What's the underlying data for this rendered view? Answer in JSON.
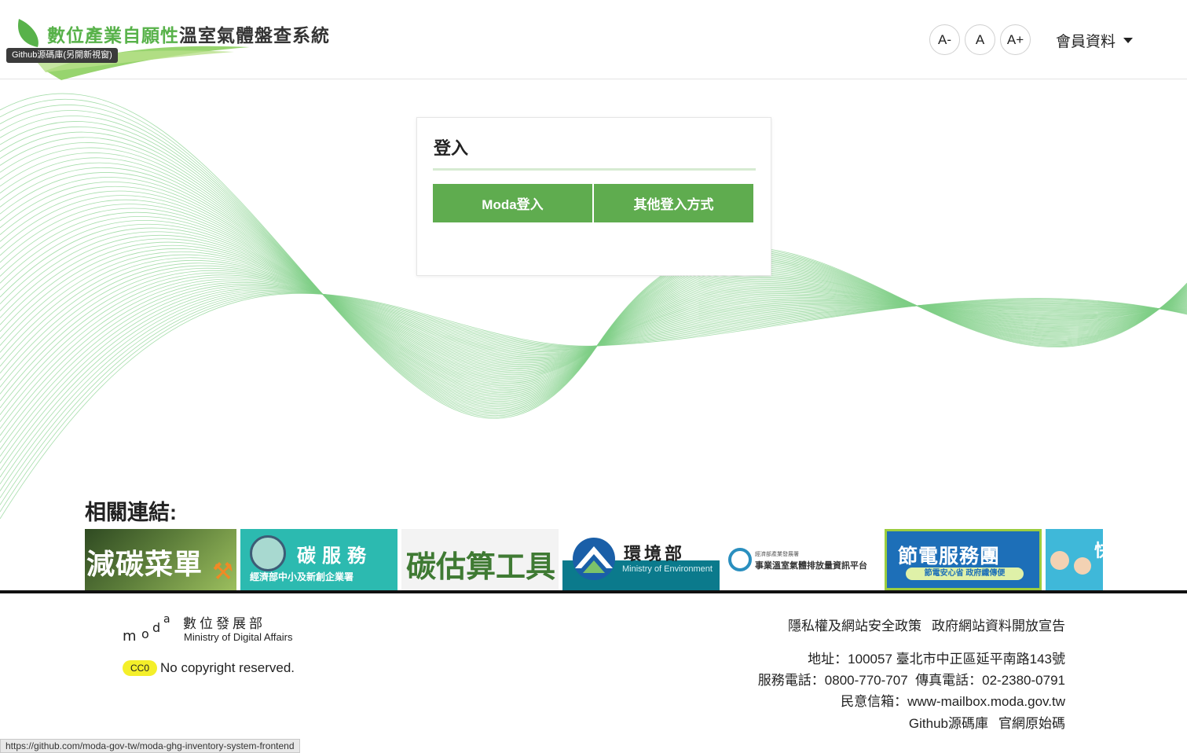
{
  "header": {
    "title_green": "數位產業自願性",
    "title_dark": "溫室氣體盤查系統",
    "github_tooltip": "Github源碼庫(另開新視窗)",
    "font_small": "A-",
    "font_normal": "A",
    "font_large": "A+",
    "member_menu": "會員資料"
  },
  "login": {
    "title": "登入",
    "moda_login": "Moda登入",
    "other_login": "其他登入方式"
  },
  "related": {
    "title": "相關連結:",
    "banners": [
      {
        "name": "減碳菜單"
      },
      {
        "name": "碳服務",
        "subtitle": "經濟部中小及新創企業署"
      },
      {
        "name": "碳估算工具"
      },
      {
        "name": "環境部",
        "subtitle": "Ministry of Environment"
      },
      {
        "name": "事業溫室氣體排放量資訊平台",
        "subtitle": "經濟部產業發展署"
      },
      {
        "name": "節電服務團",
        "subtitle": "節電安心省 政府纖傳便"
      },
      {
        "name": "快"
      }
    ]
  },
  "footer": {
    "org_name": "數位發展部",
    "org_en": "Ministry of Digital Affairs",
    "cc0": "CC0",
    "copyright": "No copyright reserved.",
    "privacy_link": "隱私權及網站安全政策",
    "opendata_link": "政府網站資料開放宣告",
    "address": "地址：100057 臺北市中正區延平南路143號",
    "phone": "服務電話：0800-770-707",
    "fax": "傳真電話：02-2380-0791",
    "mailbox": "民意信箱：www-mailbox.moda.gov.tw",
    "github_repo": "Github源碼庫",
    "source_code": "官網原始碼"
  },
  "status_bar": {
    "url": "https://github.com/moda-gov-tw/moda-ghg-inventory-system-frontend"
  },
  "colors": {
    "brand_green": "#5fac4f",
    "title_green": "#58b24a",
    "wave_green": "#7fcf86"
  }
}
